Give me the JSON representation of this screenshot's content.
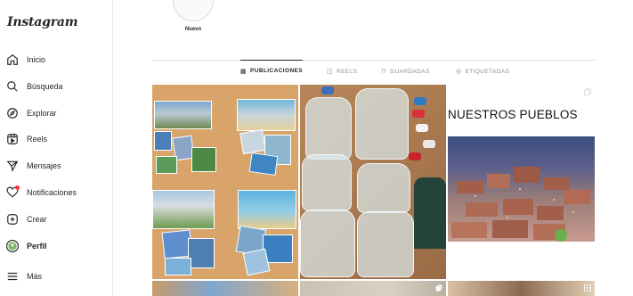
{
  "app": {
    "logo_text": "Instagram"
  },
  "sidebar": {
    "items": [
      {
        "label": "Inicio",
        "icon": "home-icon"
      },
      {
        "label": "Búsqueda",
        "icon": "search-icon"
      },
      {
        "label": "Explorar",
        "icon": "compass-icon"
      },
      {
        "label": "Reels",
        "icon": "reels-icon"
      },
      {
        "label": "Mensajes",
        "icon": "send-icon"
      },
      {
        "label": "Notificaciones",
        "icon": "heart-icon"
      },
      {
        "label": "Crear",
        "icon": "plus-square-icon"
      },
      {
        "label": "Perfil",
        "icon": "avatar-icon"
      },
      {
        "label": "Más",
        "icon": "menu-icon"
      }
    ],
    "active_item": "Perfil",
    "notification_dot_color": "#ff3040"
  },
  "highlights": [
    {
      "label": "Nuevo"
    }
  ],
  "tabs": [
    {
      "label": "PUBLICACIONES",
      "icon": "grid-icon",
      "active": true
    },
    {
      "label": "REELS",
      "icon": "reels-icon",
      "active": false
    },
    {
      "label": "GUARDADAS",
      "icon": "bookmark-icon",
      "active": false
    },
    {
      "label": "ETIQUETADAS",
      "icon": "tag-user-icon",
      "active": false
    }
  ],
  "posts": [
    {
      "description_icon": "none"
    },
    {
      "description_icon": "none"
    },
    {
      "overlay_text": "NUESTROS PUEBLOS",
      "description_icon": "carousel-icon"
    }
  ],
  "colors": {
    "border": "#dbdbdb",
    "text": "#262626",
    "muted": "#8e8e8e"
  }
}
